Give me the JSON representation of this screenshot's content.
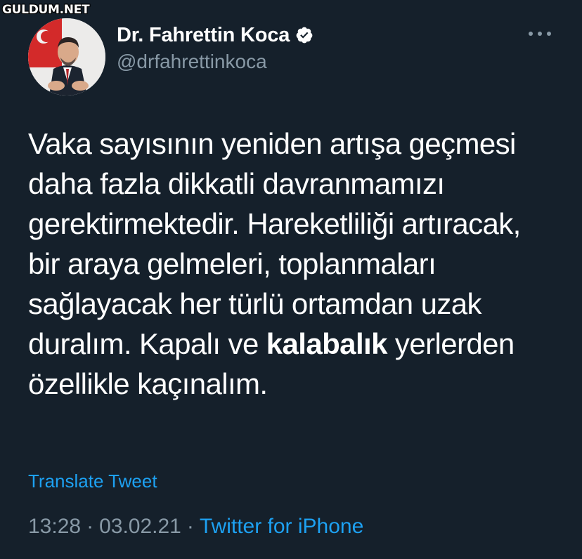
{
  "watermark": "GULDUM.NET",
  "tweet": {
    "author": {
      "display_name": "Dr. Fahrettin Koca",
      "handle": "@drfahrettinkoca",
      "verified_icon": "verified-badge-icon"
    },
    "more_icon": "more-horizontal-icon",
    "text_lines": [
      "Vaka sayısının yeniden artışa geçmesi",
      "daha fazla dikkatli davranmamızı",
      "gerektirmektedir. Hareketliliği artıracak,",
      "bir araya gelmeleri, toplanmaları",
      "sağlayacak her türlü ortamdan uzak"
    ],
    "line6": {
      "before": "duralım. Kapalı ve ",
      "bold": "kalabalık",
      "after": " yerlerden"
    },
    "line7": "özellikle kaçınalım.",
    "translate_label": "Translate Tweet",
    "time": "13:28",
    "date": "03.02.21",
    "separator": "·",
    "source": "Twitter for iPhone"
  },
  "colors": {
    "background": "#15202b",
    "text": "#ffffff",
    "muted": "#8899a6",
    "accent": "#1da1f2"
  }
}
